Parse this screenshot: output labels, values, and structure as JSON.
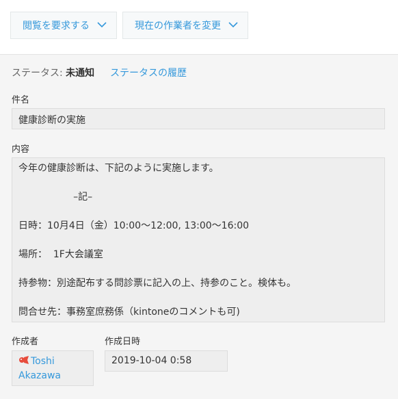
{
  "toolbar": {
    "request_view_label": "閲覧を要求する",
    "change_assignee_label": "現在の作業者を変更"
  },
  "status": {
    "prefix": "ステータス: ",
    "value": "未通知",
    "history_link": "ステータスの履歴"
  },
  "fields": {
    "subject": {
      "label": "件名",
      "value": "健康診断の実施"
    },
    "content": {
      "label": "内容",
      "lines": [
        "今年の健康診断は、下記のように実施します。",
        "",
        "                  –記–",
        "",
        "日時：10月4日（金）10:00〜12:00, 13:00〜16:00",
        "",
        "場所：  1F大会議室",
        "",
        "持参物：別途配布する問診票に記入の上、持参のこと。検体も。",
        "",
        "問合せ先：事務室庶務係（kintoneのコメントも可)"
      ]
    },
    "creator": {
      "label": "作成者",
      "name_line1": "Toshi",
      "name_line2": "Akazawa",
      "icon": "user-avatar-icon"
    },
    "created_at": {
      "label": "作成日時",
      "value": "2019-10-04 0:58"
    }
  },
  "colors": {
    "link": "#3498db",
    "field_bg": "#eeeeee",
    "page_bg": "#f5f5f5"
  }
}
